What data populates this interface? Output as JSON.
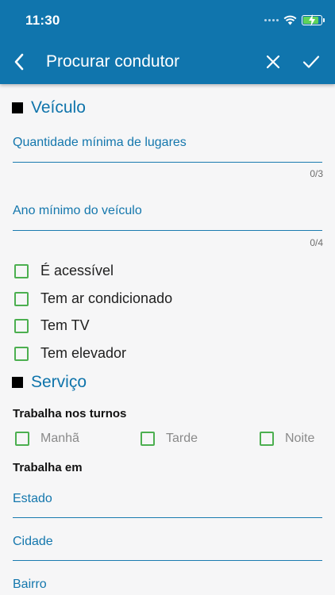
{
  "status": {
    "time": "11:30"
  },
  "header": {
    "title": "Procurar condutor"
  },
  "vehicle": {
    "title": "Veículo",
    "min_seats": {
      "label": "Quantidade mínima de lugares",
      "value": "",
      "counter": "0/3"
    },
    "min_year": {
      "label": "Ano mínimo do veículo",
      "value": "",
      "counter": "0/4"
    },
    "options": [
      {
        "label": "É acessível",
        "checked": false
      },
      {
        "label": "Tem ar condicionado",
        "checked": false
      },
      {
        "label": "Tem TV",
        "checked": false
      },
      {
        "label": "Tem elevador",
        "checked": false
      }
    ]
  },
  "service": {
    "title": "Serviço",
    "shifts_heading": "Trabalha nos turnos",
    "shifts": [
      {
        "label": "Manhã",
        "checked": false
      },
      {
        "label": "Tarde",
        "checked": false
      },
      {
        "label": "Noite",
        "checked": false
      }
    ],
    "works_in_heading": "Trabalha em",
    "state_label": "Estado",
    "city_label": "Cidade",
    "district_label": "Bairro"
  },
  "colors": {
    "header_bg": "#1075ad",
    "accent_text": "#1477ad",
    "checkbox_border": "#4caf50",
    "background": "#f6f6f7"
  }
}
